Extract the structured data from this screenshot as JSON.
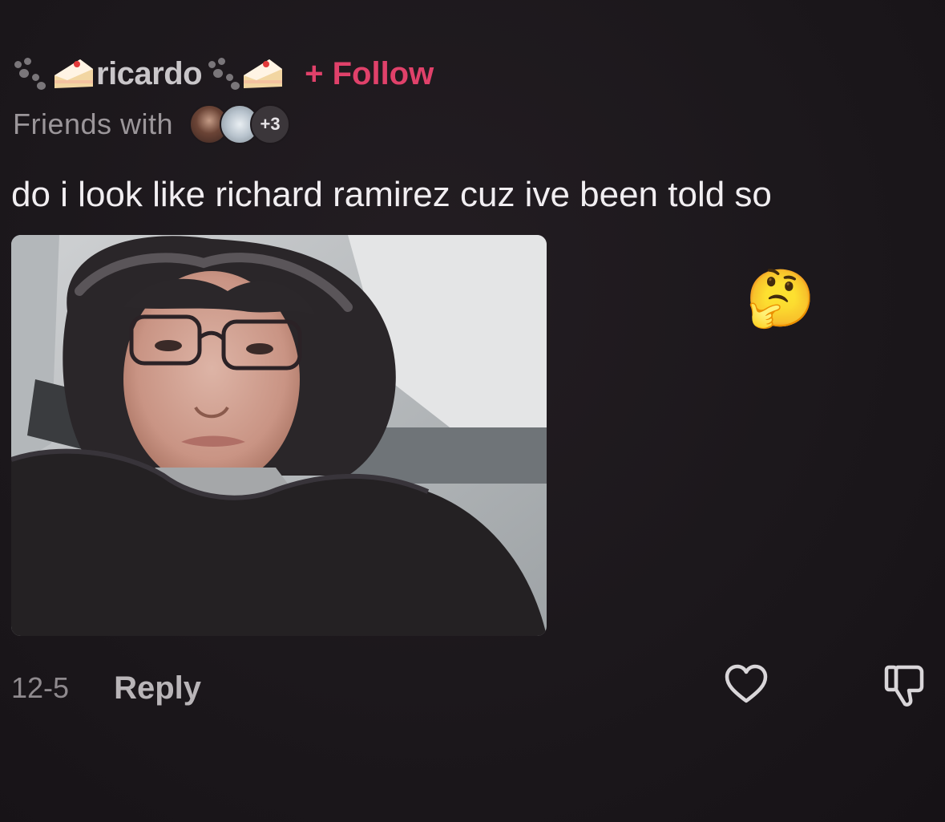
{
  "comment": {
    "username": "ricardo",
    "follow_label": "+ Follow",
    "friends_label": "Friends with",
    "friends_more_count": "+3",
    "text": "do i look like richard ramirez cuz ive been told so",
    "date": "12-5",
    "reply_label": "Reply",
    "emoji": "🤔"
  },
  "icons": {
    "decor": [
      "paw-print-icon",
      "cake-slice-icon"
    ],
    "actions": [
      "heart-icon",
      "thumbs-down-icon"
    ]
  },
  "colors": {
    "background": "#1d181c",
    "follow": "#e0416a",
    "text": "#f1eef1",
    "muted": "#9b969a"
  }
}
